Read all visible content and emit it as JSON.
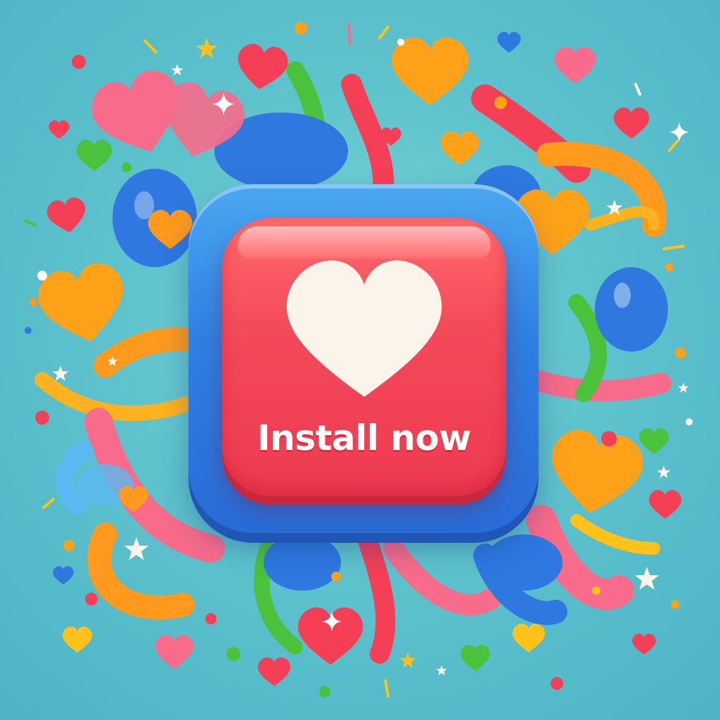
{
  "screen": {
    "background": "#5ec3cc"
  },
  "install_button": {
    "label": "Install now",
    "icon": "heart-icon",
    "color": "#f44a5a",
    "frame_color": "#2f7fe3"
  },
  "decor_palette": {
    "red": "#f43f57",
    "pink": "#f86b8a",
    "orange": "#ff9a1f",
    "yellow": "#ffc21a",
    "green": "#4cc23c",
    "blue": "#2f78e0",
    "white": "#fdf6ea"
  }
}
